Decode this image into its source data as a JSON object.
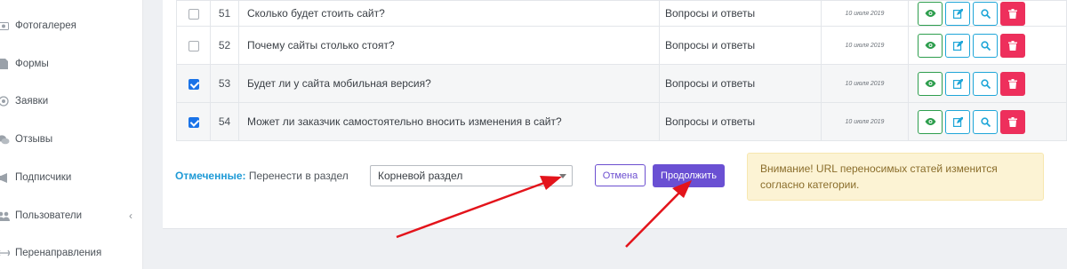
{
  "sidebar": {
    "items": [
      {
        "label": "Фотогалерея",
        "icon": "image-icon"
      },
      {
        "label": "Формы",
        "icon": "document-icon"
      },
      {
        "label": "Заявки",
        "icon": "target-icon"
      },
      {
        "label": "Отзывы",
        "icon": "comments-icon"
      },
      {
        "label": "Подписчики",
        "icon": "megaphone-icon"
      },
      {
        "label": "Пользователи",
        "icon": "users-icon",
        "chevron": "‹"
      },
      {
        "label": "Перенаправления",
        "icon": "arrows-icon"
      }
    ]
  },
  "table": {
    "rows": [
      {
        "num": "51",
        "title": "Сколько будет стоить сайт?",
        "section": "Вопросы и ответы",
        "date": "10 июля 2019",
        "checked": false
      },
      {
        "num": "52",
        "title": "Почему сайты столько стоят?",
        "section": "Вопросы и ответы",
        "date": "10 июля 2019",
        "checked": false
      },
      {
        "num": "53",
        "title": "Будет ли у сайта мобильная версия?",
        "section": "Вопросы и ответы",
        "date": "10 июля 2019",
        "checked": true
      },
      {
        "num": "54",
        "title": "Может ли заказчик самостоятельно вносить изменения в сайт?",
        "section": "Вопросы и ответы",
        "date": "10 июля 2019",
        "checked": true
      }
    ]
  },
  "bulk": {
    "label_bold": "Отмеченные:",
    "label_text": " Перенести в раздел",
    "select_value": "Корневой раздел",
    "cancel_label": "Отмена",
    "continue_label": "Продолжить",
    "alert_text": "Внимание! URL переносимых статей изменится согласно категории."
  },
  "colors": {
    "accent": "#6a50d3",
    "link": "#1e9ad6",
    "view": "#2e9e4e",
    "edit": "#1fa6d8",
    "delete": "#ee2f5c",
    "annotation_arrow": "#e3141b"
  }
}
